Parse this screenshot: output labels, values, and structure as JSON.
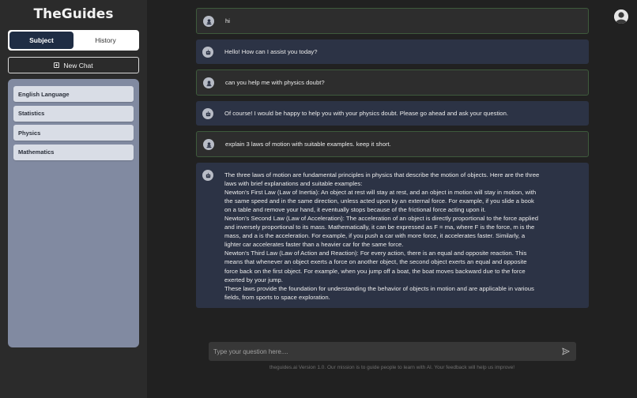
{
  "brand": "TheGuides",
  "toggle": {
    "subject": "Subject",
    "history": "History"
  },
  "new_chat": "New Chat",
  "subjects": [
    "English Language",
    "Statistics",
    "Physics",
    "Mathematics"
  ],
  "messages": [
    {
      "role": "user",
      "lines": [
        "hi"
      ]
    },
    {
      "role": "bot",
      "lines": [
        "Hello! How can I assist you today?"
      ]
    },
    {
      "role": "user",
      "lines": [
        "can you help me with physics doubt?"
      ]
    },
    {
      "role": "bot",
      "lines": [
        "Of course! I would be happy to help you with your physics doubt. Please go ahead and ask your question."
      ]
    },
    {
      "role": "user",
      "lines": [
        "explain 3 laws of motion with suitable examples. keep it short."
      ]
    },
    {
      "role": "bot",
      "lines": [
        "The three laws of motion are fundamental principles in physics that describe the motion of objects. Here are the three",
        "laws with brief explanations and suitable examples:",
        "Newton's First Law (Law of Inertia): An object at rest will stay at rest, and an object in motion will stay in motion, with",
        "the same speed and in the same direction, unless acted upon by an external force. For example, if you slide a book",
        "on a table and remove your hand, it eventually stops because of the frictional force acting upon it.",
        "Newton's Second Law (Law of Acceleration): The acceleration of an object is directly proportional to the force applied",
        "and inversely proportional to its mass. Mathematically, it can be expressed as F = ma, where F is the force, m is the",
        "mass, and a is the acceleration. For example, if you push a car with more force, it accelerates faster. Similarly, a",
        "lighter car accelerates faster than a heavier car for the same force.",
        "Newton's Third Law (Law of Action and Reaction): For every action, there is an equal and opposite reaction. This",
        "means that whenever an object exerts a force on another object, the second object exerts an equal and opposite",
        "force back on the first object. For example, when you jump off a boat, the boat moves backward due to the force",
        "exerted by your jump.",
        "These laws provide the foundation for understanding the behavior of objects in motion and are applicable in various",
        "fields, from sports to space exploration."
      ]
    }
  ],
  "input": {
    "placeholder": "Type your question here....",
    "value": ""
  },
  "footer": "theguides.ai Version 1.0. Our mission is to guide people to learn with AI. Your feedback will help us improve!"
}
